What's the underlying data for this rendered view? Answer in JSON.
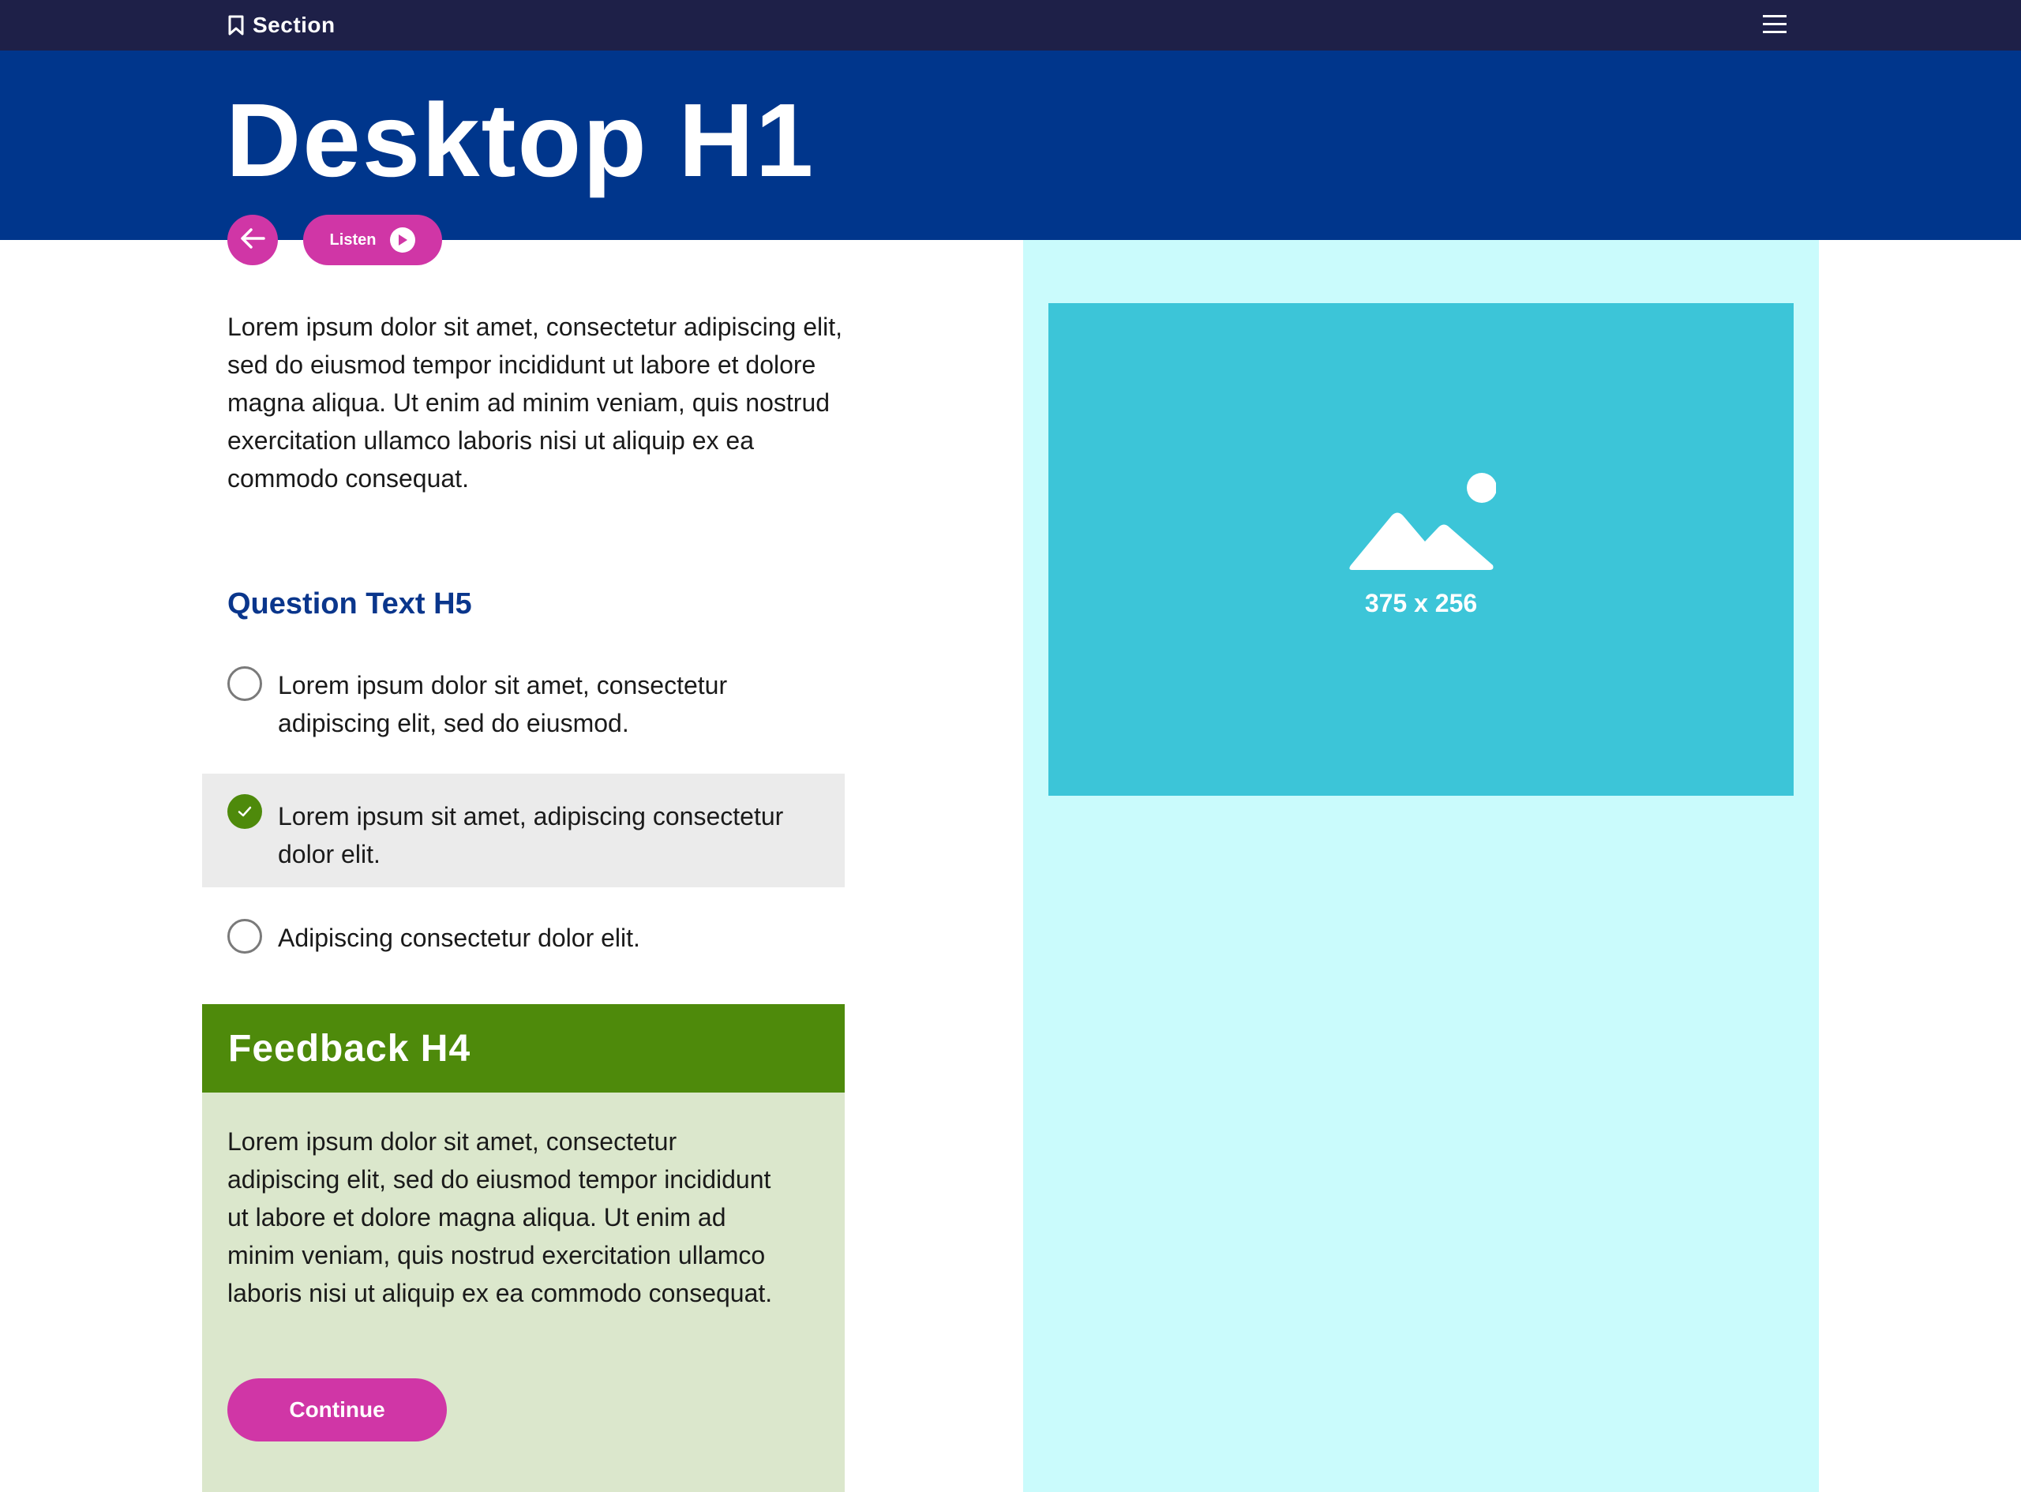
{
  "header": {
    "section_label": "Section",
    "icons": {
      "section": "bookmark-icon",
      "menu": "hamburger-menu-icon"
    }
  },
  "hero": {
    "title": "Desktop H1",
    "background_color": "#00368c"
  },
  "controls": {
    "back_icon": "arrow-left-icon",
    "listen_label": "Listen",
    "listen_icon": "play-circle-icon",
    "accent_color": "#d036a6"
  },
  "intro_text": "Lorem ipsum dolor sit amet, consectetur adipiscing elit, sed do eiusmod tempor incididunt ut labore et dolore magna aliqua. Ut enim ad minim veniam, quis nostrud exercitation ullamco laboris nisi ut aliquip ex ea commodo consequat.",
  "question": {
    "title": "Question Text H5",
    "options": [
      {
        "label": "Lorem ipsum dolor sit amet, consectetur adipiscing elit, sed do eiusmod.",
        "selected": false
      },
      {
        "label": "Lorem ipsum sit amet, adipiscing consectetur dolor elit.",
        "selected": true
      },
      {
        "label": "Adipiscing consectetur dolor elit.",
        "selected": false
      }
    ]
  },
  "feedback": {
    "title": "Feedback H4",
    "body": "Lorem ipsum dolor sit amet, consectetur adipiscing elit, sed do eiusmod tempor incididunt ut labore et dolore magna aliqua. Ut enim ad minim veniam, quis nostrud exercitation ullamco laboris nisi ut aliquip ex ea commodo consequat.",
    "continue_label": "Continue",
    "header_color": "#4e8a0b"
  },
  "media": {
    "placeholder_label": "375 x 256",
    "placeholder_icon": "image-placeholder-icon",
    "panel_color": "#cafbfc",
    "placeholder_color": "#3cc5d8"
  }
}
